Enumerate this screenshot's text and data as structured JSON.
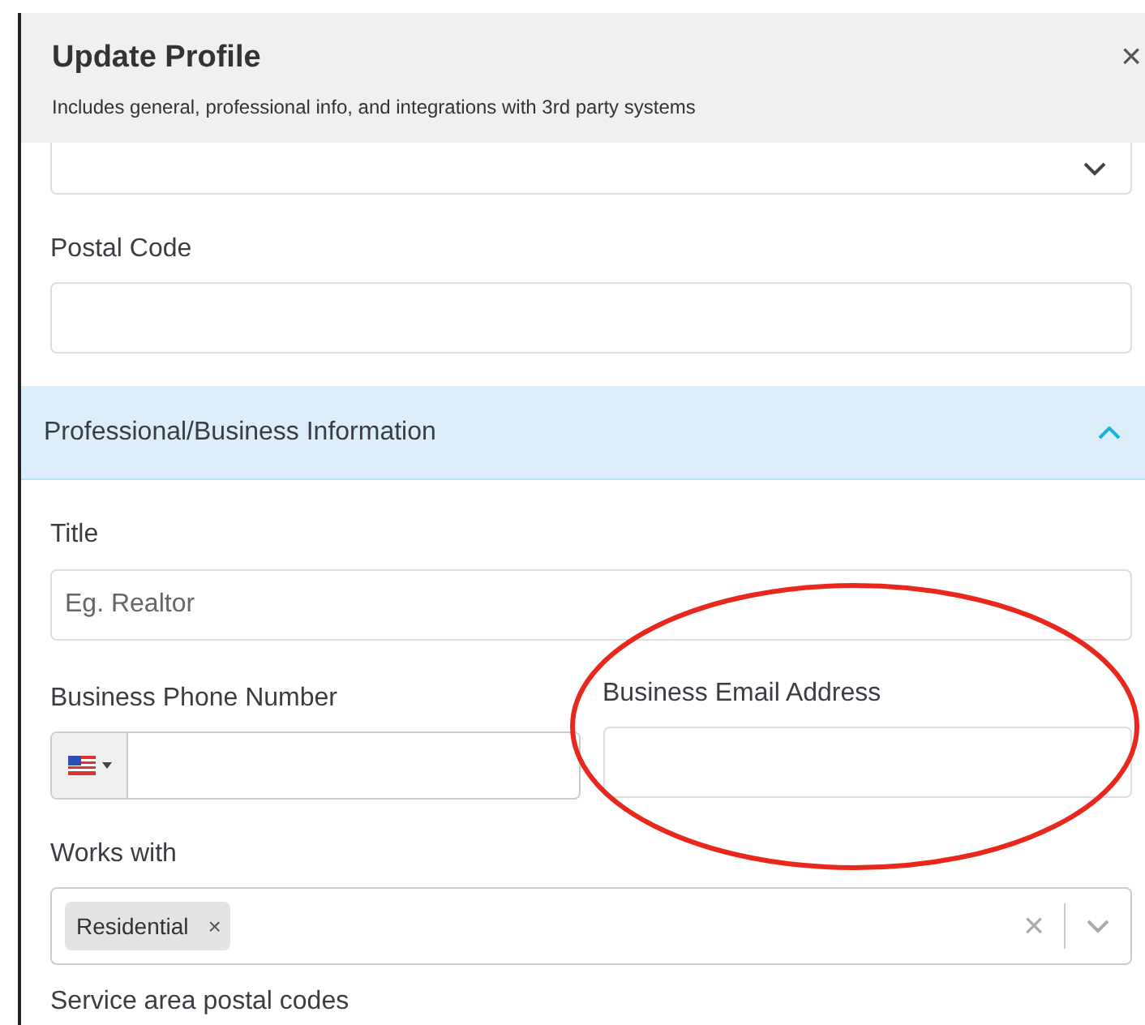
{
  "header": {
    "title": "Update Profile",
    "subtitle": "Includes general, professional info, and integrations with 3rd party systems",
    "close": "×"
  },
  "top_select": {
    "kind": "select"
  },
  "postal_code": {
    "label": "Postal Code"
  },
  "section": {
    "title": "Professional/Business Information",
    "expanded": true
  },
  "title_field": {
    "label": "Title",
    "placeholder": "Eg. Realtor"
  },
  "phone": {
    "label": "Business Phone Number"
  },
  "email": {
    "label": "Business Email Address"
  },
  "works_with": {
    "label": "Works with",
    "tags": [
      {
        "label": "Residential",
        "remove": "×"
      }
    ],
    "clear": "×"
  },
  "service_area": {
    "label": "Service area postal codes"
  }
}
